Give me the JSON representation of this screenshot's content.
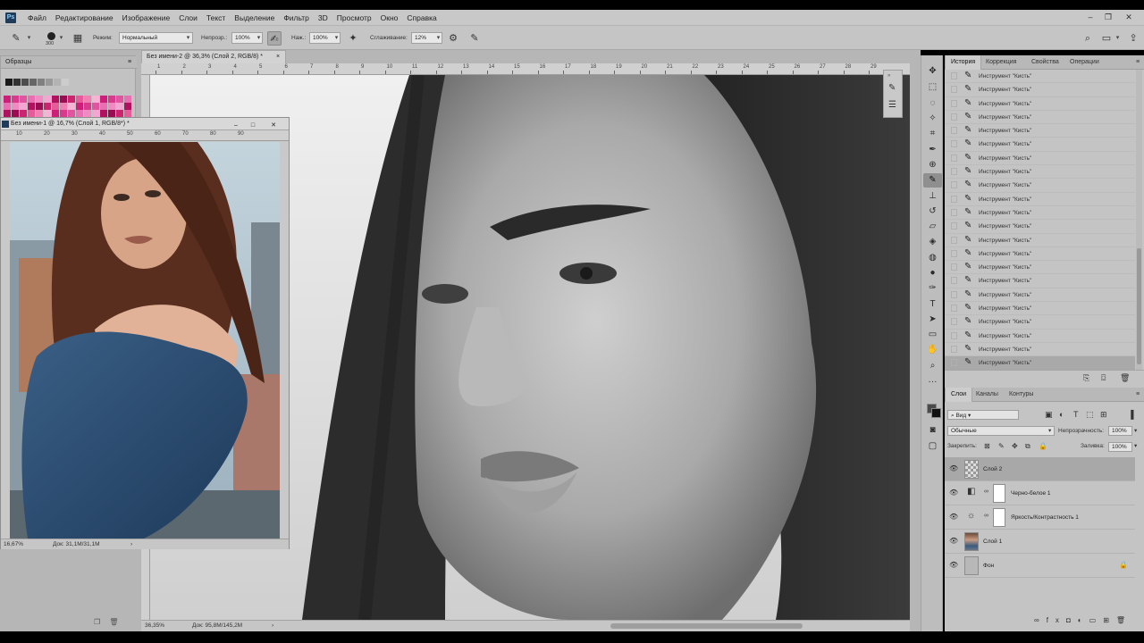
{
  "app": {
    "logo": "Ps",
    "menu": [
      "Файл",
      "Редактирование",
      "Изображение",
      "Слои",
      "Текст",
      "Выделение",
      "Фильтр",
      "3D",
      "Просмотр",
      "Окно",
      "Справка"
    ]
  },
  "options_bar": {
    "brush_size": "300",
    "mode_label": "Режим:",
    "mode_value": "Нормальный",
    "opacity_label": "Непрозр.:",
    "opacity_value": "100%",
    "pressure_label": "Наж.:",
    "pressure_value": "100%",
    "smoothing_label": "Сглаживание:",
    "smoothing_value": "12%"
  },
  "swatches_panel": {
    "title": "Образцы",
    "colors": [
      "#cc1f7a",
      "#d83a8d",
      "#e0559f",
      "#e86fb1",
      "#ef8ac2",
      "#f4a6d3",
      "#b0125f",
      "#9b0d52",
      "#c9266f",
      "#e65b9a",
      "#f080b3",
      "#f7b3d4"
    ]
  },
  "main_document": {
    "tab_title": "Без имени-2 @ 36,3% (Слой 2, RGB/8) *",
    "close": "×",
    "zoom": "36,35%",
    "doc_info": "Док: 95,8M/145,2M",
    "ruler_numbers": [
      "1",
      "2",
      "3",
      "4",
      "5",
      "6",
      "7",
      "8",
      "9",
      "10",
      "11",
      "12",
      "13",
      "14",
      "15",
      "16",
      "17",
      "18",
      "19",
      "20",
      "21",
      "22",
      "23",
      "24",
      "25",
      "26",
      "27",
      "28",
      "29"
    ]
  },
  "float_document": {
    "title": "Без имени-1 @ 16,7% (Слой 1, RGB/8*) *",
    "zoom": "16,67%",
    "doc_info": "Док: 31,1M/31,1M",
    "ruler_numbers": [
      "10",
      "20",
      "30",
      "40",
      "50",
      "60",
      "70",
      "80",
      "90"
    ]
  },
  "history_panel": {
    "tabs": [
      "История",
      "Коррекция",
      "Свойства",
      "Операции"
    ],
    "active_tab": "История",
    "entries": [
      "Инструмент \"Кисть\"",
      "Инструмент \"Кисть\"",
      "Инструмент \"Кисть\"",
      "Инструмент \"Кисть\"",
      "Инструмент \"Кисть\"",
      "Инструмент \"Кисть\"",
      "Инструмент \"Кисть\"",
      "Инструмент \"Кисть\"",
      "Инструмент \"Кисть\"",
      "Инструмент \"Кисть\"",
      "Инструмент \"Кисть\"",
      "Инструмент \"Кисть\"",
      "Инструмент \"Кисть\"",
      "Инструмент \"Кисть\"",
      "Инструмент \"Кисть\"",
      "Инструмент \"Кисть\"",
      "Инструмент \"Кисть\"",
      "Инструмент \"Кисть\"",
      "Инструмент \"Кисть\"",
      "Инструмент \"Кисть\"",
      "Инструмент \"Кисть\"",
      "Инструмент \"Кисть\""
    ]
  },
  "layers_panel": {
    "tabs": [
      "Слои",
      "Каналы",
      "Контуры"
    ],
    "active_tab": "Слои",
    "filter_value": "Вид",
    "blend_mode": "Обычные",
    "opacity_label": "Непрозрачность:",
    "opacity_value": "100%",
    "lock_label": "Закрепить:",
    "fill_label": "Заливка:",
    "fill_value": "100%",
    "layers": [
      {
        "name": "Слой 2",
        "type": "pixel",
        "selected": true
      },
      {
        "name": "Черно-белое 1",
        "type": "adjustment"
      },
      {
        "name": "Яркость/Контрастность 1",
        "type": "adjustment"
      },
      {
        "name": "Слой 1",
        "type": "photo"
      },
      {
        "name": "Фон",
        "type": "background",
        "locked": true
      }
    ]
  }
}
